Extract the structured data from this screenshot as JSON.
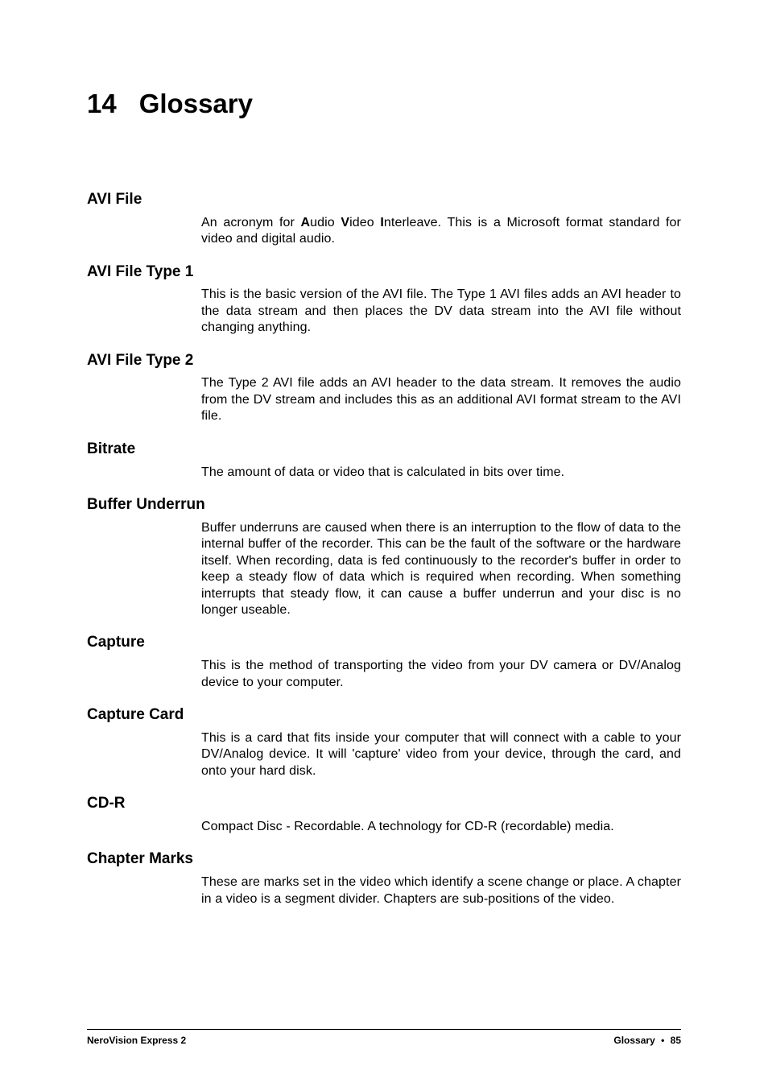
{
  "chapter": {
    "number": "14",
    "title": "Glossary"
  },
  "entries": [
    {
      "term": "AVI File",
      "def_pre": "An acronym for ",
      "b1": "A",
      "mid1": "udio ",
      "b2": "V",
      "mid2": "ideo ",
      "b3": "I",
      "def_post": "nterleave. This is a Microsoft format standard for video and digital audio."
    },
    {
      "term": "AVI File Type 1",
      "def": "This is the basic version of the AVI file. The Type 1 AVI files adds an AVI header to the data stream and then places the DV data stream into the AVI file without changing anything."
    },
    {
      "term": "AVI File Type 2",
      "def": "The Type 2 AVI file adds an AVI header to the data stream. It removes the audio from the DV stream and includes this as an additional AVI format stream to the AVI file."
    },
    {
      "term": "Bitrate",
      "def": "The amount of data or video that is calculated in bits over time."
    },
    {
      "term": "Buffer Underrun",
      "def": "Buffer underruns are caused when there is an interruption to the flow of data to the internal buffer of the recorder. This can be the fault of the software or the hardware itself. When recording, data is fed continuously to the recorder's buffer in order to keep a steady flow of data which is required when recording. When something interrupts that steady flow, it can cause a buffer underrun and your disc is no longer useable."
    },
    {
      "term": "Capture",
      "def": "This is the method of transporting the video from your DV camera or DV/Analog device to your computer."
    },
    {
      "term": "Capture Card",
      "def": "This is a card that fits inside your computer that will connect with a cable to your DV/Analog device. It will 'capture' video from your device, through the card, and onto your hard disk."
    },
    {
      "term": "CD-R",
      "def": "Compact Disc - Recordable. A technology for CD-R (recordable) media."
    },
    {
      "term": "Chapter Marks",
      "def": "These are marks set in the video which identify a scene change or place. A chapter in a video is a segment divider. Chapters are sub-positions of the video."
    }
  ],
  "footer": {
    "left": "NeroVision Express 2",
    "right_section": "Glossary",
    "bullet": "•",
    "page": "85"
  }
}
